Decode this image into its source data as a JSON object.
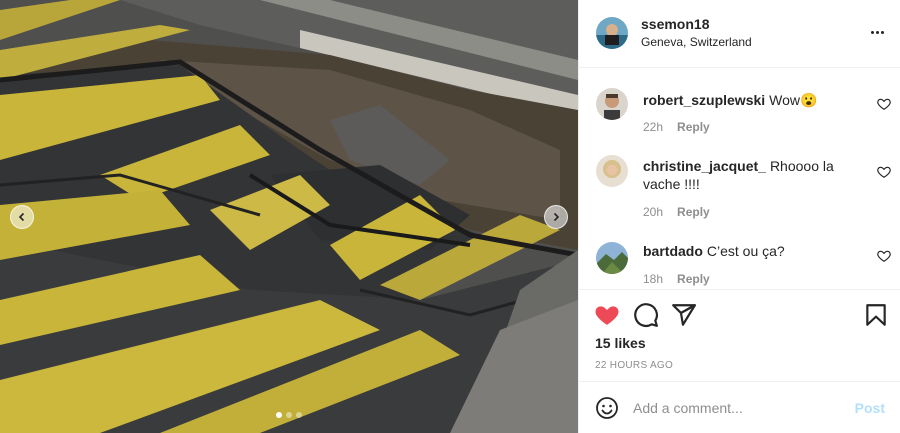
{
  "post": {
    "username": "ssemon18",
    "location": "Geneva, Switzerland",
    "likes": "15 likes",
    "time_ago": "22 HOURS AGO"
  },
  "carousel": {
    "dots": 3,
    "active_index": 0
  },
  "comments": [
    {
      "user": "robert_szuplewski",
      "text": "Wow😮",
      "time": "22h",
      "reply": "Reply"
    },
    {
      "user": "christine_jacquet_",
      "text": "Rhoooo la vache !!!!",
      "time": "20h",
      "reply": "Reply"
    },
    {
      "user": "bartdado",
      "text": "C’est ou ça?",
      "time": "18h",
      "reply": "Reply"
    }
  ],
  "composer": {
    "placeholder": "Add a comment...",
    "post_label": "Post"
  },
  "colors": {
    "like_red": "#ed4956",
    "post_disabled": "#b2dffc",
    "road_yellow": "#c8b53a",
    "asphalt": "#3a3b3d"
  },
  "icons": [
    "more-icon",
    "heart-icon",
    "comment-icon",
    "share-icon",
    "bookmark-icon",
    "emoji-icon",
    "chevron-left-icon",
    "chevron-right-icon"
  ]
}
